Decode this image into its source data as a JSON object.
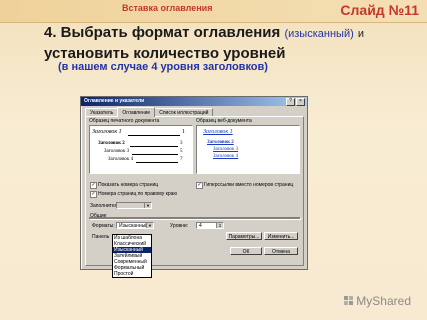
{
  "slide": {
    "header": "Вставка оглавления",
    "number": "Слайд №11",
    "step_num": "4",
    "step_text_a": ". Выбрать формат оглавления",
    "step_hint": "(изысканный)",
    "step_and": "и",
    "step_text_b": "установить количество уровней",
    "note": "(в нашем случае 4 уровня заголовков)"
  },
  "dialog": {
    "title": "Оглавление и указатели",
    "tabs": [
      "Указатель",
      "Оглавление",
      "Список иллюстраций"
    ],
    "print_preview_label": "Образец печатного документа",
    "web_preview_label": "Образец веб-документа",
    "print_preview": [
      {
        "text": "Заголовок 1",
        "page": "1"
      },
      {
        "text": "Заголовок 2",
        "page": "3"
      },
      {
        "text": "Заголовок 3",
        "page": "5"
      },
      {
        "text": "Заголовок 4",
        "page": "7"
      }
    ],
    "web_preview": [
      "Заголовок 1",
      "Заголовок 2",
      "Заголовок 3",
      "Заголовок 4"
    ],
    "show_page_numbers": "Показать номера страниц",
    "align_right": "Номера страниц по правому краю",
    "hyperlinks": "Гиперссылки вместо номеров страниц",
    "leader_label": "Заполнитель:",
    "general_label": "Общие",
    "formats_label": "Форматы:",
    "formats_value": "Изысканный",
    "levels_label": "Уровни:",
    "levels_value": "4",
    "panel_label": "Панель",
    "options_button": "Параметры...",
    "modify_button": "Изменить...",
    "ok_button": "ОК",
    "cancel_button": "Отмена",
    "format_options": [
      "Из шаблона",
      "Классический",
      "Изысканный",
      "Затейливый",
      "Современный",
      "Формальный",
      "Простой"
    ],
    "selected_index": 2
  },
  "watermark": "MyShared",
  "colors": {
    "accent": "#c0392b",
    "note": "#2233aa",
    "select": "#0a246a"
  }
}
